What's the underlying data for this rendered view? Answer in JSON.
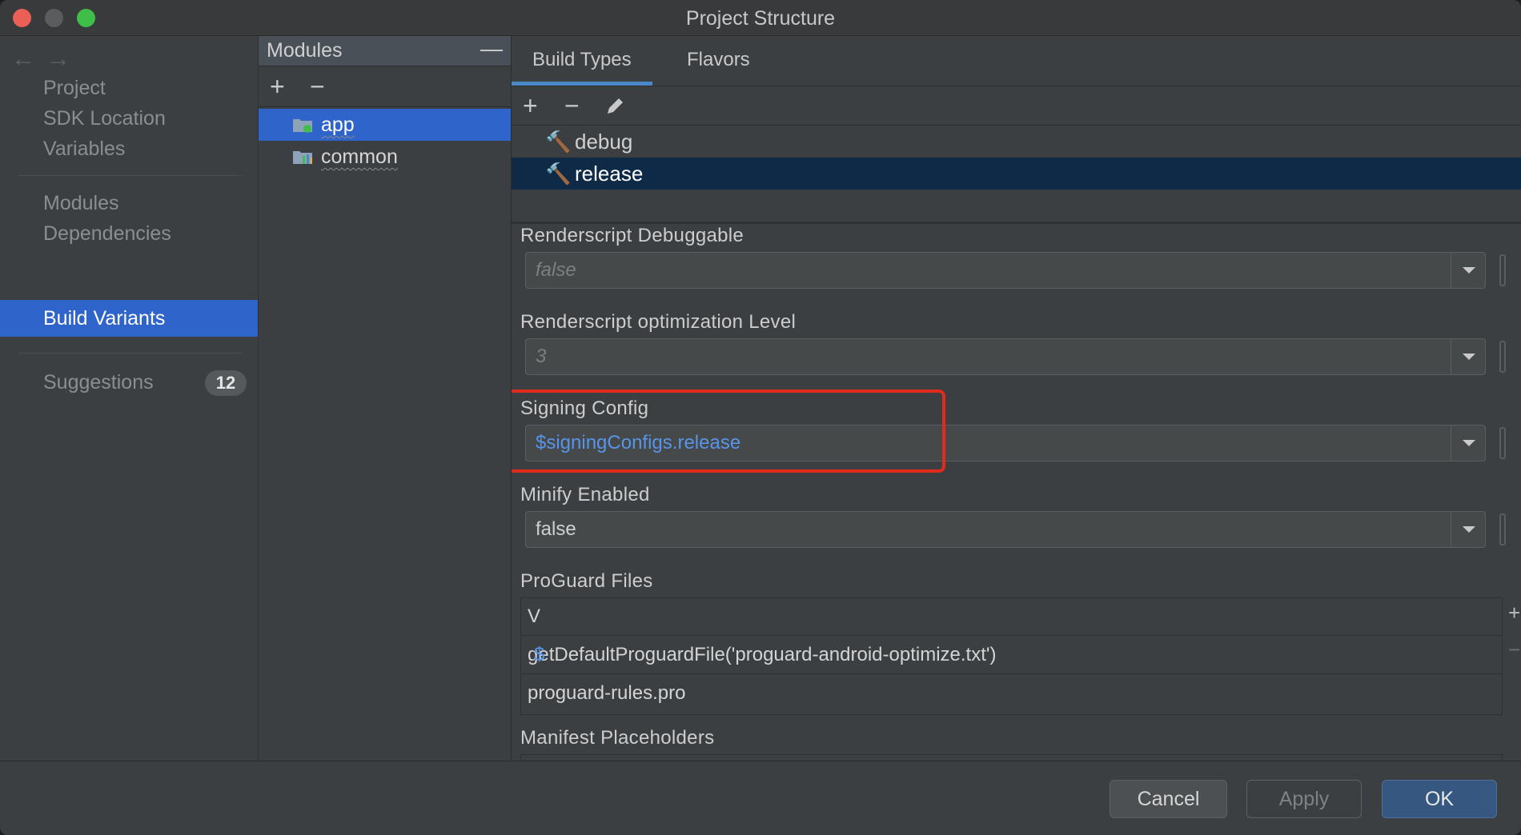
{
  "window": {
    "title": "Project Structure"
  },
  "nav": {
    "back": "←",
    "forward": "→",
    "items": [
      {
        "label": "Project"
      },
      {
        "label": "SDK Location"
      },
      {
        "label": "Variables"
      },
      {
        "label": "Modules"
      },
      {
        "label": "Dependencies"
      },
      {
        "label": "Build Variants"
      },
      {
        "label": "Suggestions"
      }
    ],
    "active_item": "Build Variants",
    "suggestions_count": "12"
  },
  "modules_panel": {
    "title": "Modules",
    "collapse": "—",
    "add": "+",
    "remove": "−",
    "items": [
      {
        "label": "app",
        "selected": true
      },
      {
        "label": "common",
        "selected": false
      }
    ]
  },
  "tabs": [
    {
      "label": "Build Types",
      "active": true
    },
    {
      "label": "Flavors",
      "active": false
    }
  ],
  "build_types": {
    "add": "+",
    "remove": "−",
    "items": [
      {
        "label": "debug",
        "selected": false
      },
      {
        "label": "release",
        "selected": true
      }
    ]
  },
  "properties": {
    "renderscript_debuggable": {
      "label": "Renderscript Debuggable",
      "value": "false"
    },
    "renderscript_opt_level": {
      "label": "Renderscript optimization Level",
      "value": "3"
    },
    "signing_config": {
      "label": "Signing Config",
      "value": "$signingConfigs.release"
    },
    "minify_enabled": {
      "label": "Minify Enabled",
      "value": "false"
    },
    "proguard_files": {
      "label": "ProGuard Files",
      "header": "V",
      "rows": [
        {
          "prefix": "$",
          "value": "getDefaultProguardFile('proguard-android-optimize.txt')"
        },
        {
          "prefix": "",
          "value": "proguard-rules.pro"
        }
      ],
      "add": "+",
      "remove": "−"
    },
    "manifest_placeholders": {
      "label": "Manifest Placeholders"
    }
  },
  "buttons": {
    "cancel": "Cancel",
    "apply": "Apply",
    "ok": "OK"
  },
  "colors": {
    "accent": "#2f65ca",
    "highlight_box": "#e22a1d",
    "link": "#5894e8"
  }
}
